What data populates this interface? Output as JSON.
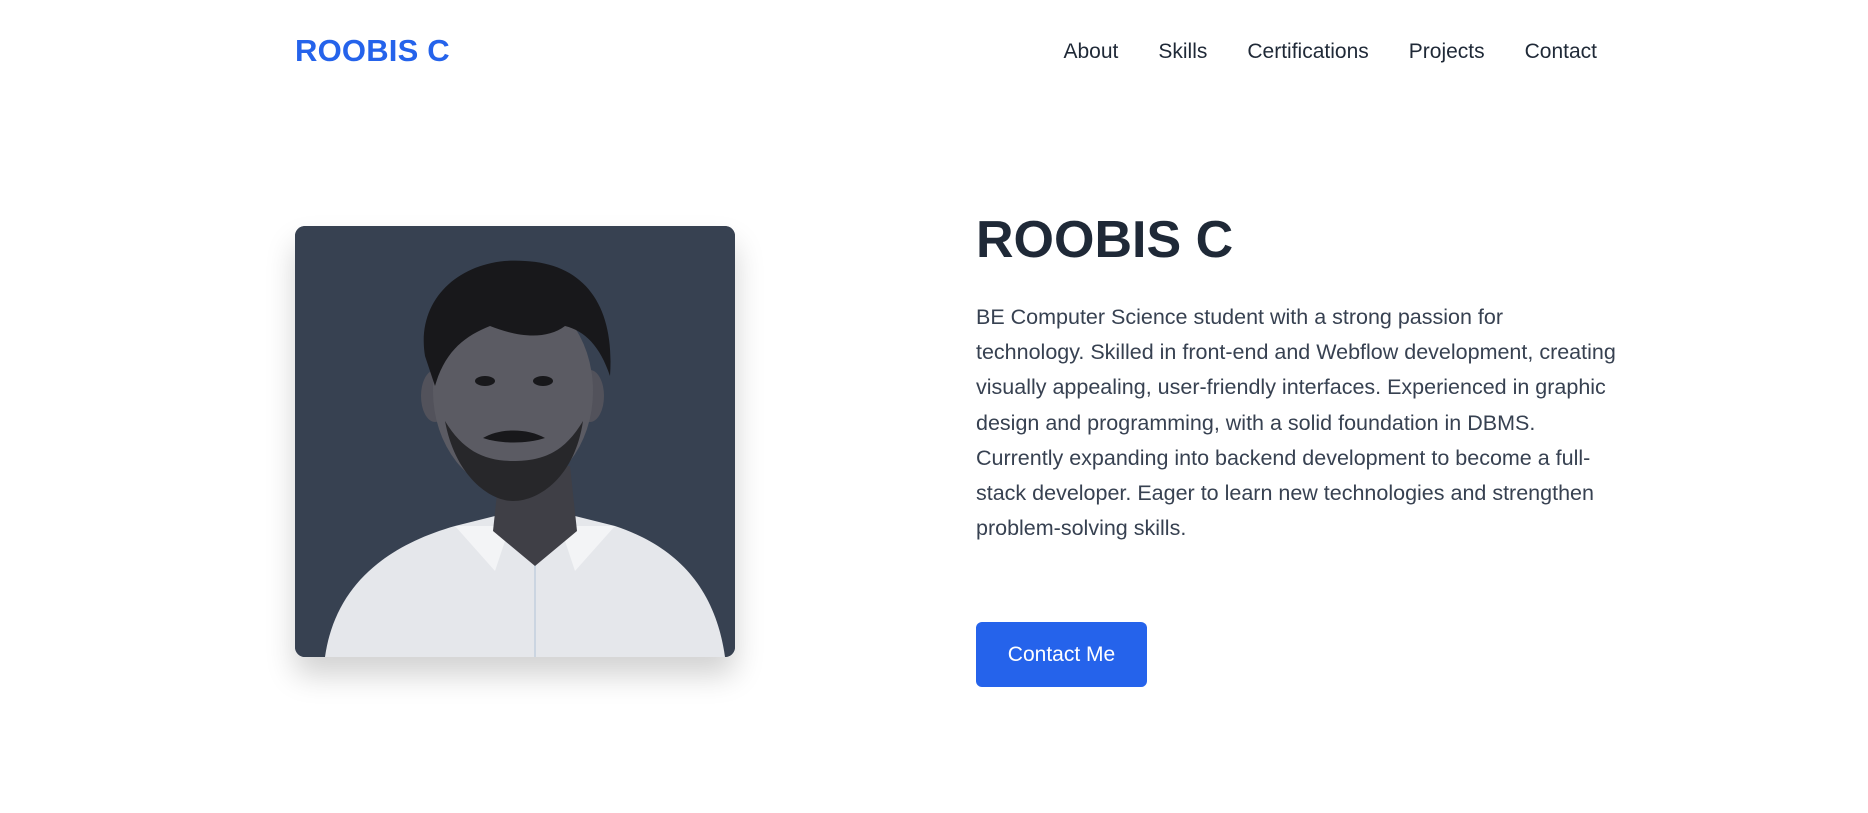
{
  "header": {
    "brand": "ROOBIS C",
    "nav": [
      {
        "label": "About"
      },
      {
        "label": "Skills"
      },
      {
        "label": "Certifications"
      },
      {
        "label": "Projects"
      },
      {
        "label": "Contact"
      }
    ]
  },
  "hero": {
    "photo_icon": "profile-photo",
    "title": "ROOBIS C",
    "description": "BE Computer Science student with a strong passion for technology. Skilled in front-end and Webflow development, creating visually appealing, user-friendly interfaces. Experienced in graphic design and programming, with a solid foundation in DBMS. Currently expanding into backend development to become a full-stack developer. Eager to learn new technologies and strengthen problem-solving skills.",
    "cta_label": "Contact Me"
  },
  "colors": {
    "brand": "#2563eb",
    "photo_background": "#374151",
    "heading": "#1f2937",
    "text": "#374151",
    "button": "#2563eb"
  }
}
